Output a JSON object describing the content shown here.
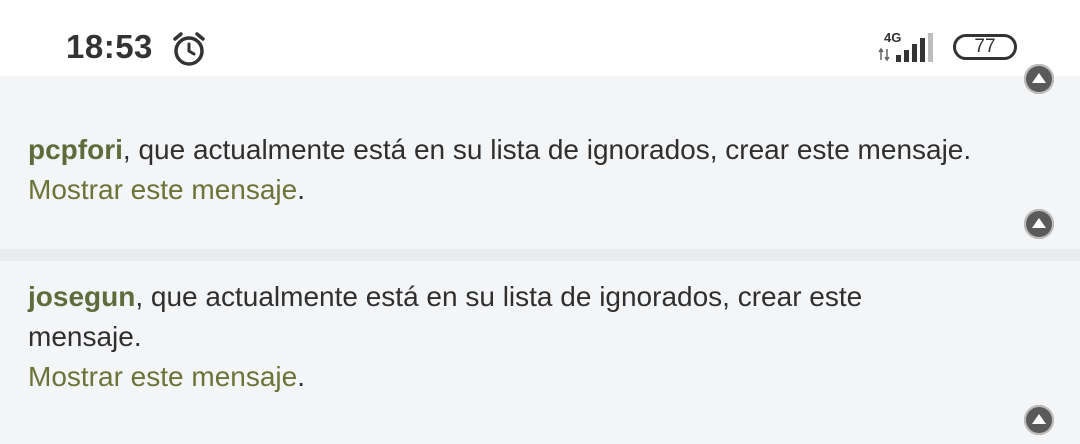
{
  "status_bar": {
    "time": "18:53",
    "alarm_icon": "alarm-clock-icon",
    "network_type": "4G",
    "signal_icon": "signal-bars-icon",
    "battery_level": "77"
  },
  "messages": [
    {
      "username": "pcpfori",
      "text": ", que actualmente está en su lista de ignorados, crear este mensaje.",
      "show_link": "Mostrar este mensaje",
      "after_link": ".",
      "scroll_icon": "scroll-up-icon"
    },
    {
      "username": "josegun",
      "text": ", que actualmente está en su lista de ignorados, crear este mensaje.",
      "show_link": "Mostrar este mensaje",
      "after_link": ".",
      "scroll_icon": "scroll-up-icon"
    }
  ],
  "colors": {
    "username": "#5f6b3a",
    "link": "#6a7338",
    "card_bg": "#f4f5f7",
    "divider_bg": "#e9ebee"
  }
}
